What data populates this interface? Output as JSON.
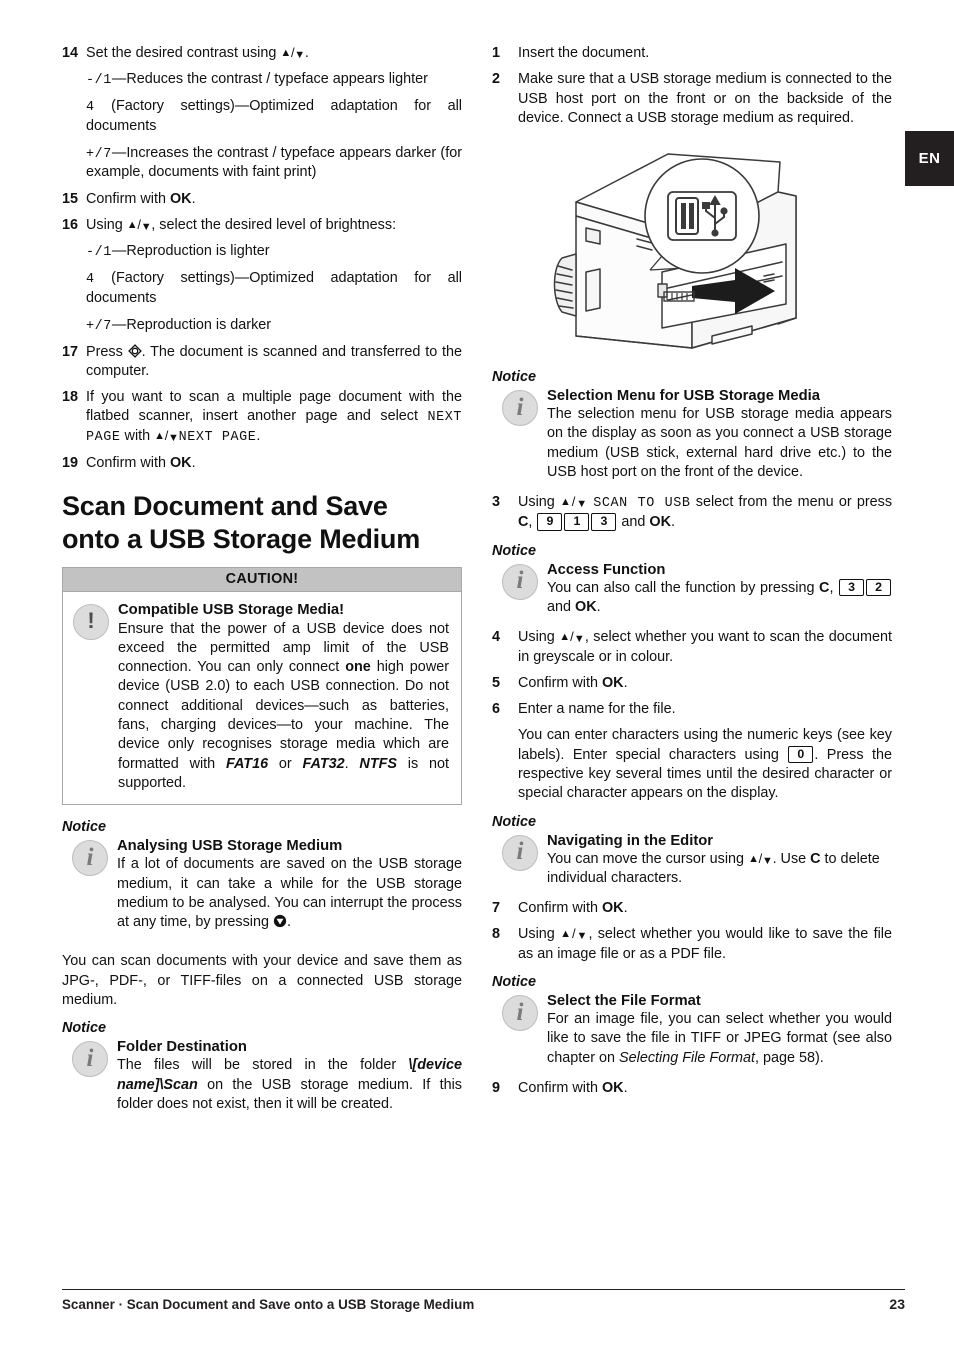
{
  "language_tab": "EN",
  "left_column": {
    "steps": [
      {
        "num": "14",
        "text_pre": "Set the desired contrast using ",
        "text_post": "."
      },
      {
        "num": "15",
        "text_pre": "Confirm with ",
        "bold": "OK",
        "text_post": "."
      },
      {
        "num": "16",
        "text_pre": "Using ",
        "text_post": ", select the desired level of brightness:"
      },
      {
        "num": "17",
        "text_pre": "Press ",
        "text_post": ". The document is scanned and transferred to the computer."
      },
      {
        "num": "18",
        "text_pre": "If you want to scan a multiple page document with the flatbed scanner, insert another page and select ",
        "lcd1": "NEXT PAGE",
        "mid": " with ",
        "lcd2": "NEXT PAGE",
        "text_post": "."
      },
      {
        "num": "19",
        "text_pre": "Confirm with ",
        "bold": "OK",
        "text_post": "."
      }
    ],
    "contrast_options": [
      {
        "lcd": "-/1",
        "text": "—Reduces the contrast / typeface appears lighter"
      },
      {
        "lcd": "4",
        "text": " (Factory settings)—Optimized adaptation for all documents"
      },
      {
        "lcd": "+/7",
        "text": "—Increases the contrast / typeface appears darker (for example, documents with faint print)"
      }
    ],
    "brightness_options": [
      {
        "lcd": "-/1",
        "text": "—Reproduction is lighter"
      },
      {
        "lcd": "4",
        "text": " (Factory settings)—Optimized adaptation for all documents"
      },
      {
        "lcd": "+/7",
        "text": "—Reproduction is darker"
      }
    ],
    "section_title_line1": "Scan Document and Save",
    "section_title_line2": "onto a USB Storage Medium",
    "caution": {
      "header": "CAUTION!",
      "title": "Compatible USB Storage Media!",
      "text_1": "Ensure that the power of a USB device does not exceed the permitted amp limit of the USB connection. You can only connect ",
      "bold_1": "one",
      "text_2": " high power device (USB 2.0) to each USB connection. Do not connect additional devices—such as batteries, fans, charging devices—to your machine. The device only recognises storage media which are formatted with ",
      "bi_1": "FAT16",
      "text_3": " or ",
      "bi_2": "FAT32",
      "text_4": ". ",
      "bi_3": "NTFS",
      "text_5": " is not supported."
    },
    "notice_analysing": {
      "label": "Notice",
      "title": "Analysing USB Storage Medium",
      "text": "If a lot of documents are saved on the USB storage medium, it can take a while for the USB storage medium to be analysed. You can interrupt the process at any time, by pressing ",
      "text_after_icon": "."
    },
    "paragraph_scan_save": "You can scan documents with your device and save them as JPG-, PDF-, or TIFF-files on a connected USB storage medium.",
    "notice_folder": {
      "label": "Notice",
      "title": "Folder Destination",
      "text_1": "The files will be stored in the folder ",
      "bi_1": "\\[device name]\\Scan",
      "text_2": " on the USB storage medium. If this folder does not exist, then it will be created."
    }
  },
  "right_column": {
    "steps": [
      {
        "num": "1",
        "text": "Insert the document."
      },
      {
        "num": "2",
        "text": "Make sure that a USB storage medium is connected to the USB host port on the front or on the backside of the device. Connect a USB storage medium as required."
      },
      {
        "num": "3",
        "text_pre": "Using ",
        "lcd": "SCAN TO USB",
        "text_mid": " select from the menu or press ",
        "bold_c": "C",
        "comma": ", ",
        "keys": [
          "9",
          "1",
          "3"
        ],
        "text_and": " and ",
        "bold_ok": "OK",
        "text_post": "."
      },
      {
        "num": "4",
        "text_pre": "Using ",
        "text_post": ", select whether you want to scan the document in greyscale or in colour."
      },
      {
        "num": "5",
        "text_pre": "Confirm with ",
        "bold": "OK",
        "text_post": "."
      },
      {
        "num": "6",
        "text": "Enter a name for the file."
      },
      {
        "num": "7",
        "text_pre": "Confirm with ",
        "bold": "OK",
        "text_post": "."
      },
      {
        "num": "8",
        "text_pre": "Using ",
        "text_post": ", select whether you would like to save the file as an image file or as a PDF file."
      },
      {
        "num": "9",
        "text_pre": "Confirm with ",
        "bold": "OK",
        "text_post": "."
      }
    ],
    "illustration_name": "printer-usb-host-port-diagram",
    "notice_selection_menu": {
      "label": "Notice",
      "title": "Selection Menu for USB Storage Media",
      "text": "The selection menu for USB storage media appears on the display as soon as you connect a USB storage medium (USB stick, external hard drive etc.) to the USB host port on the front of the device."
    },
    "notice_access_function": {
      "label": "Notice",
      "title": "Access Function",
      "text_pre": "You can also call the function by pressing ",
      "bold_c": "C",
      "comma": ", ",
      "keys": [
        "3",
        "2"
      ],
      "text_and": " and ",
      "bold_ok": "OK",
      "text_post": "."
    },
    "paragraph_characters": {
      "text_1": "You can enter characters using the numeric keys (see key labels).  Enter special characters using ",
      "key_0": "0",
      "text_2": ". Press the respective key several times until the desired character or special character appears on the display."
    },
    "notice_navigating": {
      "label": "Notice",
      "title": "Navigating in the Editor",
      "text_pre": "You can move the cursor using ",
      "text_mid": ". Use ",
      "bold_c": "C",
      "text_post": " to delete individual characters."
    },
    "notice_file_format": {
      "label": "Notice",
      "title": "Select the File Format",
      "text_1": "For an image file, you can select whether you would like to save the file in TIFF or JPEG format (see also chapter on ",
      "italic_1": "Selecting File Format",
      "text_2": ", page 58)."
    }
  },
  "footer": {
    "text": "Scanner · Scan Document and Save onto a USB Storage Medium",
    "page_number": "23"
  }
}
